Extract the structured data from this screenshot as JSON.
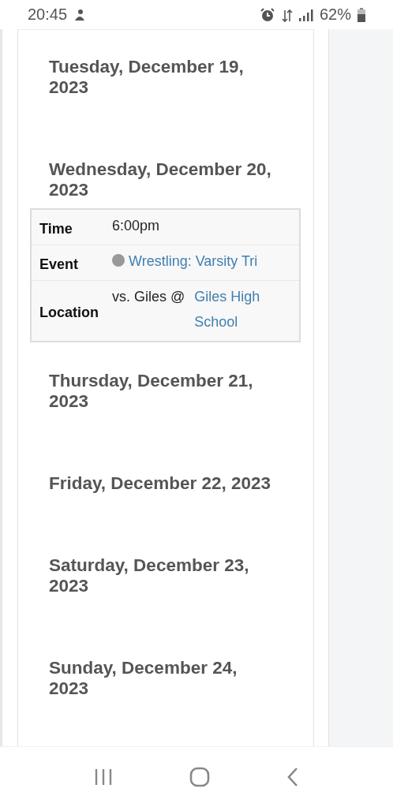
{
  "status_bar": {
    "time": "20:45",
    "battery": "62%"
  },
  "days": [
    {
      "heading": "Tuesday, December 19, 2023"
    },
    {
      "heading": "Wednesday, December 20, 2023",
      "events": [
        {
          "rows": [
            {
              "kind": "text",
              "label": "Time",
              "value": "6:00pm"
            },
            {
              "kind": "event",
              "label": "Event",
              "color": "#999999",
              "link": "Wrestling: Varsity Tri"
            },
            {
              "kind": "location",
              "label": "Location",
              "value": "vs. Giles  @",
              "link": "Giles High School"
            }
          ]
        }
      ]
    },
    {
      "heading": "Thursday, December 21, 2023"
    },
    {
      "heading": "Friday, December 22, 2023"
    },
    {
      "heading": "Saturday, December 23, 2023"
    },
    {
      "heading": "Sunday, December 24, 2023"
    }
  ]
}
